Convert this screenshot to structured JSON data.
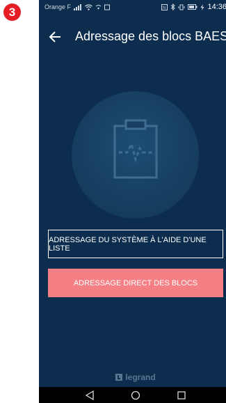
{
  "step_badge": {
    "number": "3",
    "color": "#e41e24"
  },
  "status_bar": {
    "carrier": "Orange F",
    "time": "14:36"
  },
  "header": {
    "title": "Adressage des blocs BAES",
    "back_icon": "arrow-left-icon"
  },
  "hero": {
    "icon": "clipboard-icon"
  },
  "actions": {
    "list_label": "ADRESSAGE DU SYSTÈME À L'AIDE D'UNE LISTE",
    "direct_label": "ADRESSAGE DIRECT DES BLOCS",
    "direct_color": "#f47f84"
  },
  "brand": {
    "name": "legrand"
  },
  "nav": {
    "back": "back-triangle-icon",
    "home": "home-circle-icon",
    "recents": "recents-square-icon"
  },
  "colors": {
    "background": "#0c2d4d",
    "accent": "#f47f84"
  }
}
